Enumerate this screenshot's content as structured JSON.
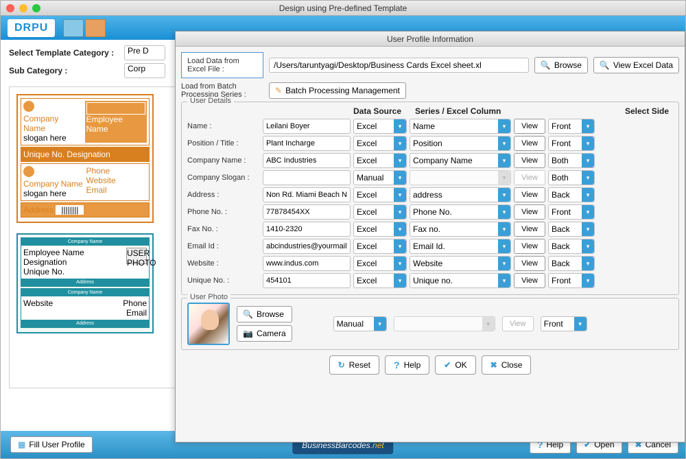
{
  "mainWindow": {
    "title": "Design using Pre-defined Template"
  },
  "banner": {
    "logo": "DRPU"
  },
  "leftForm": {
    "templateCategoryLabel": "Select Template Category :",
    "templateCategoryValue": "Pre D",
    "subCategoryLabel": "Sub Category :",
    "subCategoryValue": "Corp"
  },
  "templatePreview": {
    "companyName": "Company Name",
    "sloganHere": "slogan here",
    "employeeName": "Employee Name",
    "uniqueNo": "Unique No.",
    "designation": "Designation",
    "address": "Address",
    "phone": "Phone",
    "website": "Website",
    "email": "Email",
    "userPhoto": "USER PHOTO"
  },
  "bottomBar": {
    "fillProfile": "Fill User Profile",
    "logo1": "BusinessBarcodes",
    "logo2": ".net",
    "help": "Help",
    "open": "Open",
    "cancel": "Cancel"
  },
  "dialog": {
    "title": "User Profile Information",
    "loadExcelLabel": "Load Data from Excel File :",
    "pathValue": "/Users/taruntyagi/Desktop/Business Cards Excel sheet.xl",
    "browseBtn": "Browse",
    "viewExcelBtn": "View Excel Data",
    "loadBatchLabel": "Load from Batch Processing Series :",
    "batchBtn": "Batch Processing Management",
    "userDetailsLegend": "User Details",
    "userPhotoLegend": "User Photo",
    "headers": {
      "dataSource": "Data Source",
      "seriesCol": "Series / Excel Column",
      "selectSide": "Select Side"
    },
    "viewBtn": "View",
    "rows": [
      {
        "label": "Name :",
        "value": "Leilani Boyer",
        "source": "Excel",
        "column": "Name",
        "side": "Front",
        "viewEnabled": true
      },
      {
        "label": "Position / Title :",
        "value": "Plant Incharge",
        "source": "Excel",
        "column": "Position",
        "side": "Front",
        "viewEnabled": true
      },
      {
        "label": "Company Name :",
        "value": "ABC Industries",
        "source": "Excel",
        "column": "Company Name",
        "side": "Both",
        "viewEnabled": true
      },
      {
        "label": "Company Slogan :",
        "value": "",
        "source": "Manual",
        "column": "",
        "side": "Both",
        "viewEnabled": false
      },
      {
        "label": "Address :",
        "value": "Non Rd. Miami Beach Nor",
        "source": "Excel",
        "column": "address",
        "side": "Back",
        "viewEnabled": true
      },
      {
        "label": "Phone No. :",
        "value": "77878454XX",
        "source": "Excel",
        "column": "Phone No.",
        "side": "Front",
        "viewEnabled": true
      },
      {
        "label": "Fax No. :",
        "value": "1410-2320",
        "source": "Excel",
        "column": "Fax no.",
        "side": "Back",
        "viewEnabled": true
      },
      {
        "label": "Email Id :",
        "value": "abcindustries@yourmail.c",
        "source": "Excel",
        "column": "Email Id.",
        "side": "Back",
        "viewEnabled": true
      },
      {
        "label": "Website :",
        "value": "www.indus.com",
        "source": "Excel",
        "column": "Website",
        "side": "Back",
        "viewEnabled": true
      },
      {
        "label": "Unique No. :",
        "value": "454101",
        "source": "Excel",
        "column": "Unique no.",
        "side": "Front",
        "viewEnabled": true
      }
    ],
    "photoRow": {
      "source": "Manual",
      "column": "",
      "side": "Front",
      "viewEnabled": false
    },
    "photoBrowse": "Browse",
    "photoCamera": "Camera",
    "footer": {
      "reset": "Reset",
      "help": "Help",
      "ok": "OK",
      "close": "Close"
    }
  }
}
